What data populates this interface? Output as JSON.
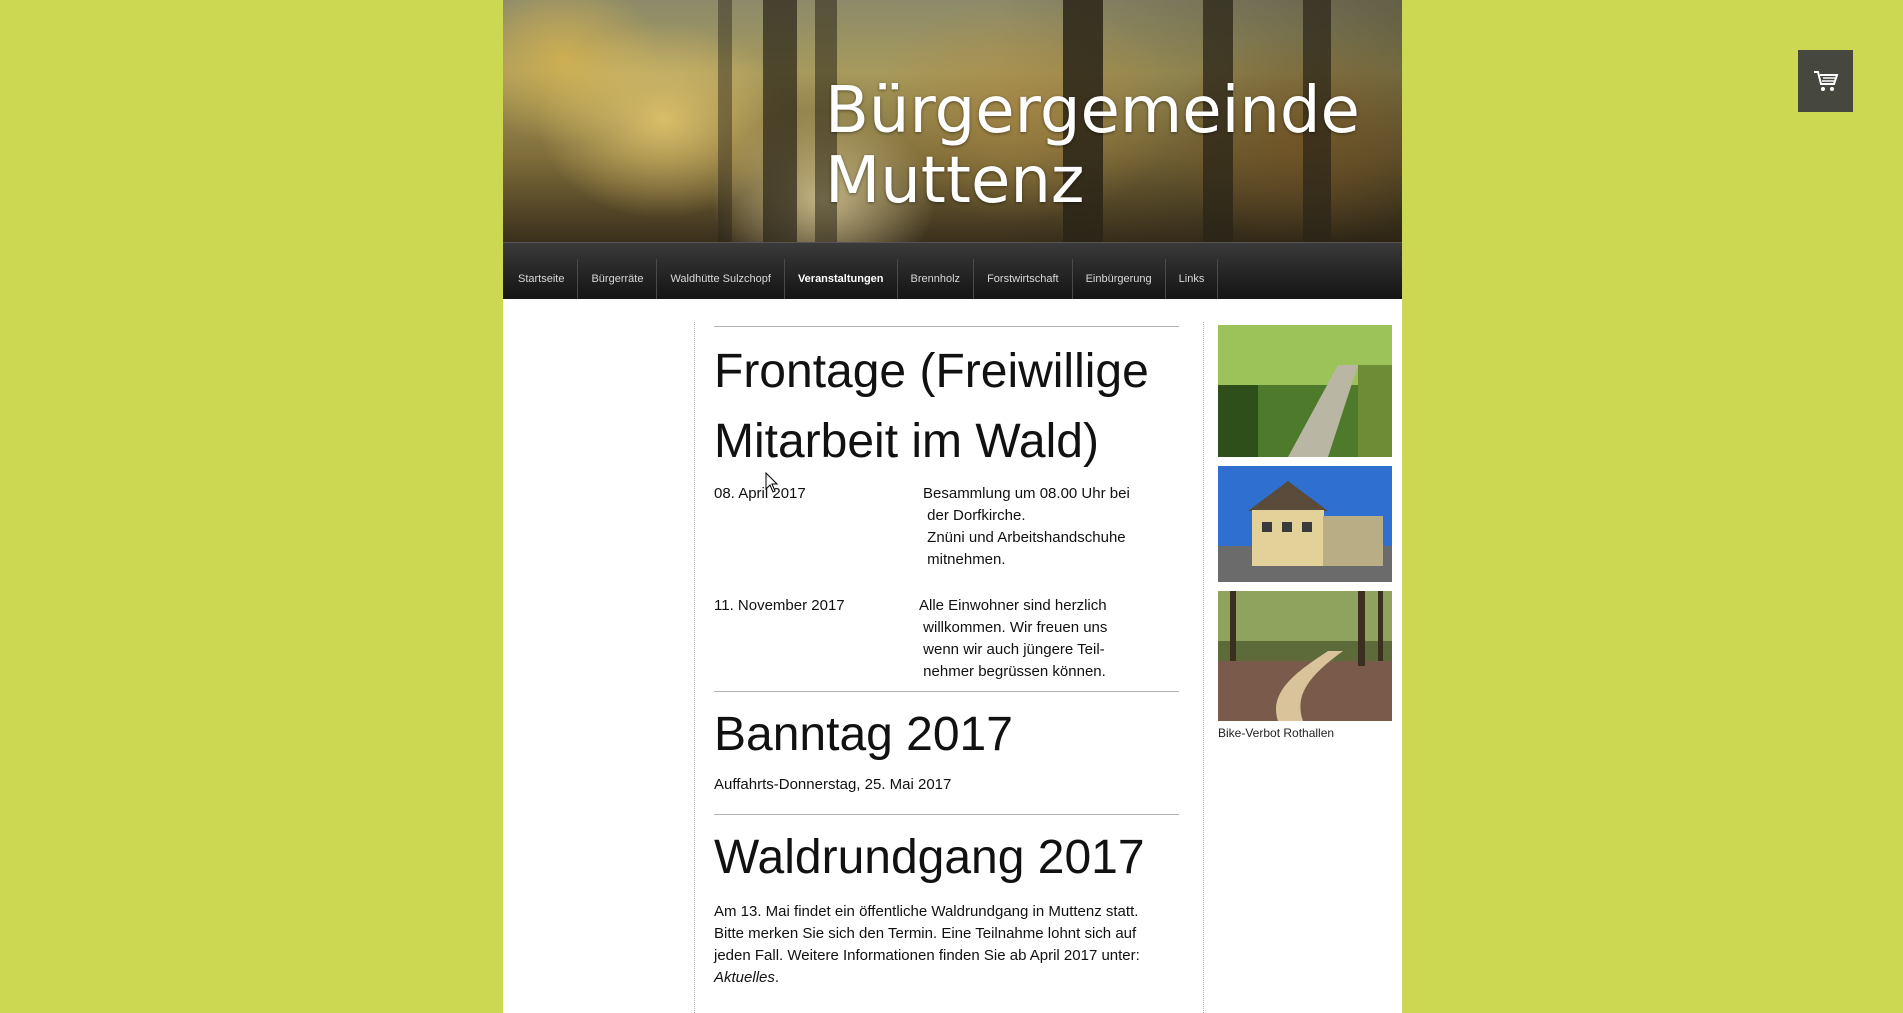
{
  "site": {
    "title_line1": "Bürgergemeinde",
    "title_line2": "Muttenz"
  },
  "nav": {
    "items": [
      {
        "label": "Startseite"
      },
      {
        "label": "Bürgerräte"
      },
      {
        "label": "Waldhütte Sulzchopf"
      },
      {
        "label": "Veranstaltungen",
        "active": true
      },
      {
        "label": "Brennholz"
      },
      {
        "label": "Forstwirtschaft"
      },
      {
        "label": "Einbürgerung"
      },
      {
        "label": "Links"
      }
    ]
  },
  "sections": {
    "frontage": {
      "heading_line1": "Frontage (Freiwillige",
      "heading_line2": "Mitarbeit im Wald)",
      "events": [
        {
          "date": "08. April 2017",
          "lines": [
            "Besammlung um 08.00 Uhr bei",
            " der Dorfkirche.",
            " Znüni und Arbeitshandschuhe",
            " mitnehmen."
          ]
        },
        {
          "date": "11. November 2017",
          "lines": [
            "Alle Einwohner sind herzlich",
            " willkommen. Wir freuen uns",
            " wenn wir auch jüngere Teil-",
            " nehmer begrüssen können."
          ]
        }
      ]
    },
    "banntag": {
      "heading": "Banntag 2017",
      "text": "Auffahrts-Donnerstag, 25. Mai 2017"
    },
    "waldrundgang": {
      "heading": "Waldrundgang 2017",
      "lines": [
        "Am 13. Mai findet ein öffentliche Waldrundgang in Muttenz statt.",
        "Bitte merken Sie sich den Termin. Eine Teilnahme lohnt sich auf",
        "jeden Fall. Weitere Informationen finden Sie ab April 2017 unter:"
      ],
      "link_text": "Aktuelles",
      "after_link": "."
    }
  },
  "sidebar": {
    "caption": "Bike-Verbot Rothallen"
  },
  "icons": {
    "cart": "shopping-cart-icon"
  },
  "colors": {
    "background": "#cdd852",
    "nav_bg": "#1f1f1f",
    "cart_bg": "#46473f"
  }
}
